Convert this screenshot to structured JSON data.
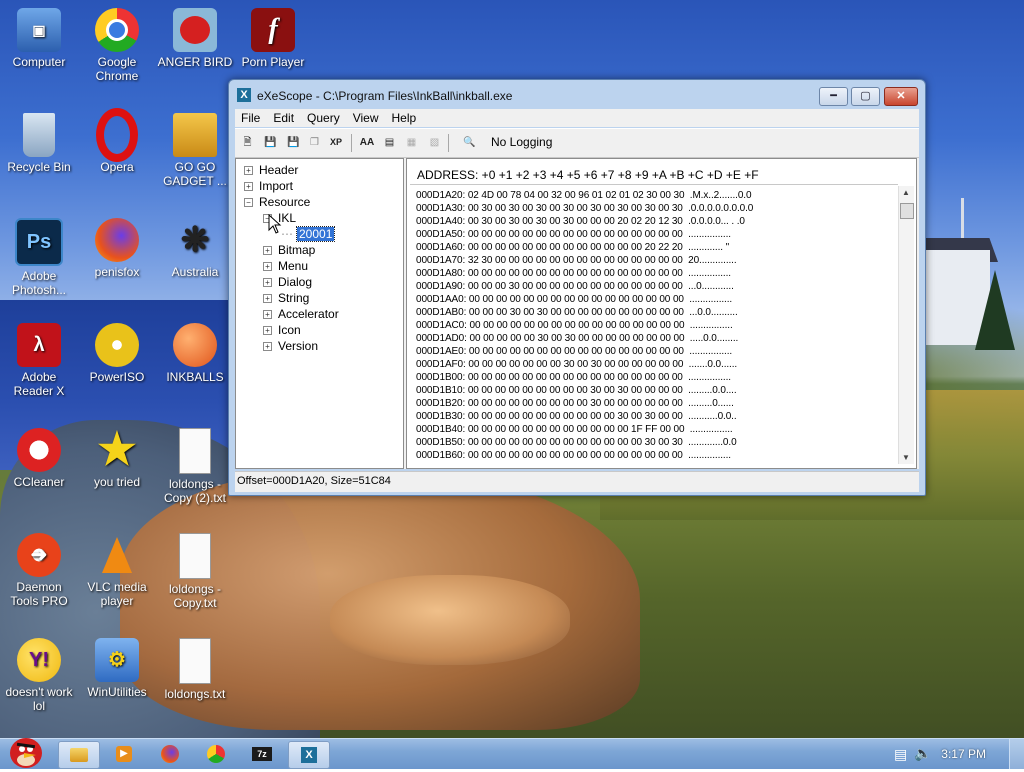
{
  "desktop": {
    "icons": [
      {
        "label": "Computer",
        "icon": "computer-icon"
      },
      {
        "label": "Google Chrome",
        "icon": "chrome-icon"
      },
      {
        "label": "ANGER BIRD",
        "icon": "angry-bird-icon"
      },
      {
        "label": "Porn Player",
        "icon": "flash-icon"
      },
      {
        "label": "Recycle Bin",
        "icon": "recycle-bin-icon"
      },
      {
        "label": "Opera",
        "icon": "opera-icon"
      },
      {
        "label": "GO GO GADGET ...",
        "icon": "folder-icon"
      },
      {
        "label": "Adobe Photosh...",
        "icon": "photoshop-icon"
      },
      {
        "label": "penisfox",
        "icon": "firefox-icon"
      },
      {
        "label": "Australia",
        "icon": "spider-icon"
      },
      {
        "label": "Adobe Reader X",
        "icon": "adobe-reader-icon"
      },
      {
        "label": "PowerISO",
        "icon": "disc-icon"
      },
      {
        "label": "INKBALLS",
        "icon": "inkball-icon"
      },
      {
        "label": "CCleaner",
        "icon": "ccleaner-icon"
      },
      {
        "label": "you tried",
        "icon": "star-icon"
      },
      {
        "label": "loldongs - Copy (2).txt",
        "icon": "text-file-icon"
      },
      {
        "label": "Daemon Tools PRO",
        "icon": "daemon-tools-icon"
      },
      {
        "label": "VLC media player",
        "icon": "vlc-icon"
      },
      {
        "label": "loldongs - Copy.txt",
        "icon": "text-file-icon"
      },
      {
        "label": "doesn't work lol",
        "icon": "yahoo-messenger-icon"
      },
      {
        "label": "WinUtilities",
        "icon": "winutilities-icon"
      },
      {
        "label": "loldongs.txt",
        "icon": "text-file-icon"
      }
    ]
  },
  "window": {
    "title": "eXeScope - C:\\Program Files\\InkBall\\inkball.exe",
    "menu": [
      "File",
      "Edit",
      "Query",
      "View",
      "Help"
    ],
    "toolbar": {
      "logging_label": "No Logging"
    },
    "tree": {
      "header": "Header",
      "import": "Import",
      "resource": "Resource",
      "ikl": "IKL",
      "selected": "20001",
      "children": [
        "Bitmap",
        "Menu",
        "Dialog",
        "String",
        "Accelerator",
        "Icon",
        "Version"
      ]
    },
    "hex": {
      "header": "ADDRESS:  +0 +1 +2 +3 +4 +5 +6 +7 +8 +9 +A +B +C +D +E +F",
      "lines": [
        "000D1A20: 02 4D 00 78 04 00 32 00 96 01 02 01 02 30 00 30  .M.x..2.......0.0",
        "000D1A30: 00 30 00 30 00 30 00 30 00 30 00 30 00 30 00 30  .0.0.0.0.0.0.0.0",
        "000D1A40: 00 30 00 30 00 30 00 30 00 00 00 20 02 20 12 30  .0.0.0.0... . .0",
        "000D1A50: 00 00 00 00 00 00 00 00 00 00 00 00 00 00 00 00  ................",
        "000D1A60: 00 00 00 00 00 00 00 00 00 00 00 00 00 20 22 20  ............. \"",
        "000D1A70: 32 30 00 00 00 00 00 00 00 00 00 00 00 00 00 00  20..............",
        "000D1A80: 00 00 00 00 00 00 00 00 00 00 00 00 00 00 00 00  ................",
        "000D1A90: 00 00 00 30 00 00 00 00 00 00 00 00 00 00 00 00  ...0............",
        "000D1AA0: 00 00 00 00 00 00 00 00 00 00 00 00 00 00 00 00  ................",
        "000D1AB0: 00 00 00 30 00 30 00 00 00 00 00 00 00 00 00 00  ...0.0..........",
        "000D1AC0: 00 00 00 00 00 00 00 00 00 00 00 00 00 00 00 00  ................",
        "000D1AD0: 00 00 00 00 00 30 00 30 00 00 00 00 00 00 00 00  .....0.0........",
        "000D1AE0: 00 00 00 00 00 00 00 00 00 00 00 00 00 00 00 00  ................",
        "000D1AF0: 00 00 00 00 00 00 00 30 00 30 00 00 00 00 00 00  .......0.0......",
        "000D1B00: 00 00 00 00 00 00 00 00 00 00 00 00 00 00 00 00  ................",
        "000D1B10: 00 00 00 00 00 00 00 00 00 30 00 30 00 00 00 00  .........0.0....",
        "000D1B20: 00 00 00 00 00 00 00 00 00 30 00 00 00 00 00 00  .........0......",
        "000D1B30: 00 00 00 00 00 00 00 00 00 00 00 30 00 30 00 00  ...........0.0..",
        "000D1B40: 00 00 00 00 00 00 00 00 00 00 00 00 1F FF 00 00  ................",
        "000D1B50: 00 00 00 00 00 00 00 00 00 00 00 00 00 30 00 30  .............0.0",
        "000D1B60: 00 00 00 00 00 00 00 00 00 00 00 00 00 00 00 00  ................"
      ]
    },
    "status": "Offset=000D1A20, Size=51C84"
  },
  "taskbar": {
    "clock": "3:17 PM",
    "items": [
      "explorer-icon",
      "media-center-icon",
      "firefox-icon",
      "chrome-icon",
      "7zip-icon",
      "exescope-icon"
    ]
  }
}
